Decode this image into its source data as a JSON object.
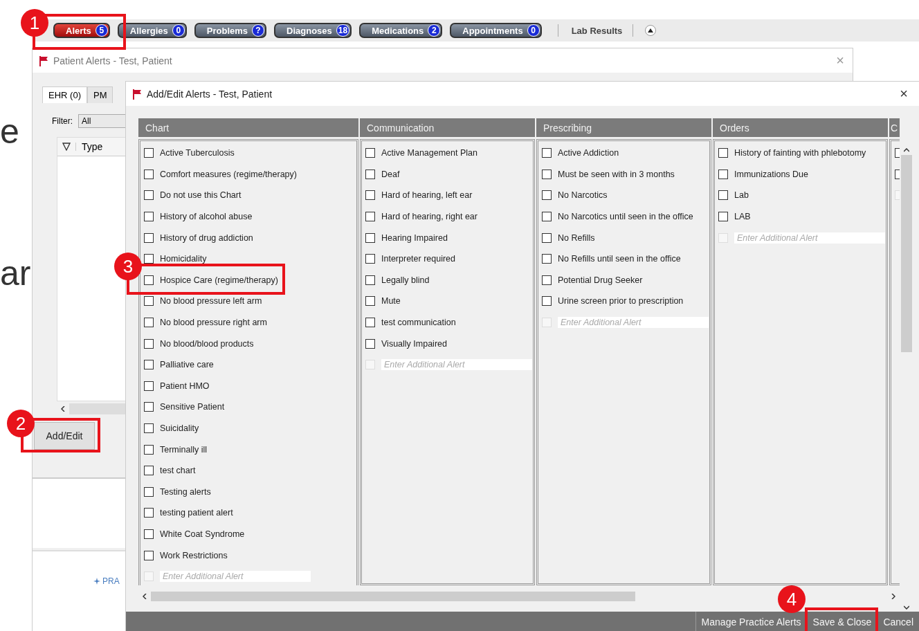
{
  "top_tabs": [
    {
      "label": "Alerts",
      "count": "5",
      "selected": true
    },
    {
      "label": "Allergies",
      "count": "0",
      "selected": false
    },
    {
      "label": "Problems",
      "count": "?",
      "selected": false
    },
    {
      "label": "Diagnoses",
      "count": "18",
      "selected": false
    },
    {
      "label": "Medications",
      "count": "2",
      "selected": false
    },
    {
      "label": "Appointments",
      "count": "0",
      "selected": false
    }
  ],
  "lab_results": "Lab Results",
  "background_text": [
    "e",
    "ar"
  ],
  "patient_alerts_window": {
    "title": "Patient Alerts - Test, Patient",
    "close_label": "×",
    "tabs": [
      {
        "label": "EHR",
        "count": "(0)",
        "selected": true
      },
      {
        "label": "PM",
        "selected": false
      }
    ],
    "filter_label": "Filter:",
    "filter_value": "All",
    "grid_columns": [
      "Type"
    ],
    "add_edit_button": "Add/Edit",
    "link": "PRA"
  },
  "add_edit_window": {
    "title": "Add/Edit Alerts - Test, Patient",
    "close_label": "×",
    "columns": [
      {
        "header": "Chart",
        "add_row": {
          "disabled": true,
          "placeholder": "Enter Additional Alert"
        },
        "items": [
          {
            "label": "Active Tuberculosis",
            "checked": false
          },
          {
            "label": "Comfort measures (regime/therapy)",
            "checked": false
          },
          {
            "label": "Do not use this Chart",
            "checked": false
          },
          {
            "label": "History of alcohol abuse",
            "checked": false
          },
          {
            "label": "History of drug addiction",
            "checked": false
          },
          {
            "label": "Homicidality",
            "checked": false
          },
          {
            "label": "Hospice Care (regime/therapy)",
            "checked": false
          },
          {
            "label": "No blood pressure left arm",
            "checked": false
          },
          {
            "label": "No blood pressure right arm",
            "checked": false
          },
          {
            "label": "No blood/blood products",
            "checked": false
          },
          {
            "label": "Palliative care",
            "checked": false
          },
          {
            "label": "Patient HMO",
            "checked": false
          },
          {
            "label": "Sensitive Patient",
            "checked": false
          },
          {
            "label": "Suicidality",
            "checked": false
          },
          {
            "label": "Terminally ill",
            "checked": false
          },
          {
            "label": "test chart",
            "checked": false
          },
          {
            "label": "Testing alerts",
            "checked": false
          },
          {
            "label": "testing patient alert",
            "checked": false
          },
          {
            "label": "White Coat Syndrome",
            "checked": false
          },
          {
            "label": "Work Restrictions",
            "checked": false
          }
        ]
      },
      {
        "header": "Communication",
        "add_row": {
          "disabled": true,
          "placeholder": "Enter Additional Alert"
        },
        "items": [
          {
            "label": "Active Management Plan",
            "checked": false
          },
          {
            "label": "Deaf",
            "checked": false
          },
          {
            "label": "Hard of hearing, left ear",
            "checked": false
          },
          {
            "label": "Hard of hearing, right ear",
            "checked": false
          },
          {
            "label": "Hearing Impaired",
            "checked": false
          },
          {
            "label": "Interpreter required",
            "checked": false
          },
          {
            "label": "Legally blind",
            "checked": false
          },
          {
            "label": "Mute",
            "checked": false
          },
          {
            "label": "test communication",
            "checked": false
          },
          {
            "label": "Visually Impaired",
            "checked": false
          }
        ]
      },
      {
        "header": "Prescribing",
        "add_row": {
          "disabled": true,
          "placeholder": "Enter Additional Alert"
        },
        "items": [
          {
            "label": "Active Addiction",
            "checked": false
          },
          {
            "label": "Must be seen with in 3 months",
            "checked": false
          },
          {
            "label": "No Narcotics",
            "checked": false
          },
          {
            "label": "No Narcotics until seen in the office",
            "checked": false
          },
          {
            "label": "No Refills",
            "checked": false
          },
          {
            "label": "No Refills until seen in the office",
            "checked": false
          },
          {
            "label": "Potential Drug Seeker",
            "checked": false
          },
          {
            "label": "Urine screen prior to prescription",
            "checked": false
          }
        ]
      },
      {
        "header": "Orders",
        "add_row": {
          "disabled": true,
          "placeholder": "Enter Additional Alert"
        },
        "items": [
          {
            "label": "History of fainting with phlebotomy",
            "checked": false
          },
          {
            "label": "Immunizations Due",
            "checked": false
          },
          {
            "label": "Lab",
            "checked": false
          },
          {
            "label": "LAB",
            "checked": false
          }
        ]
      },
      {
        "header": "C",
        "add_row": {
          "disabled": true
        },
        "items": [
          {
            "checked": false
          },
          {
            "checked": false
          }
        ]
      }
    ],
    "buttons": [
      "Manage Practice Alerts",
      "Save & Close",
      "Cancel"
    ]
  },
  "callouts": [
    {
      "number": "1"
    },
    {
      "number": "2"
    },
    {
      "number": "3"
    },
    {
      "number": "4"
    }
  ]
}
